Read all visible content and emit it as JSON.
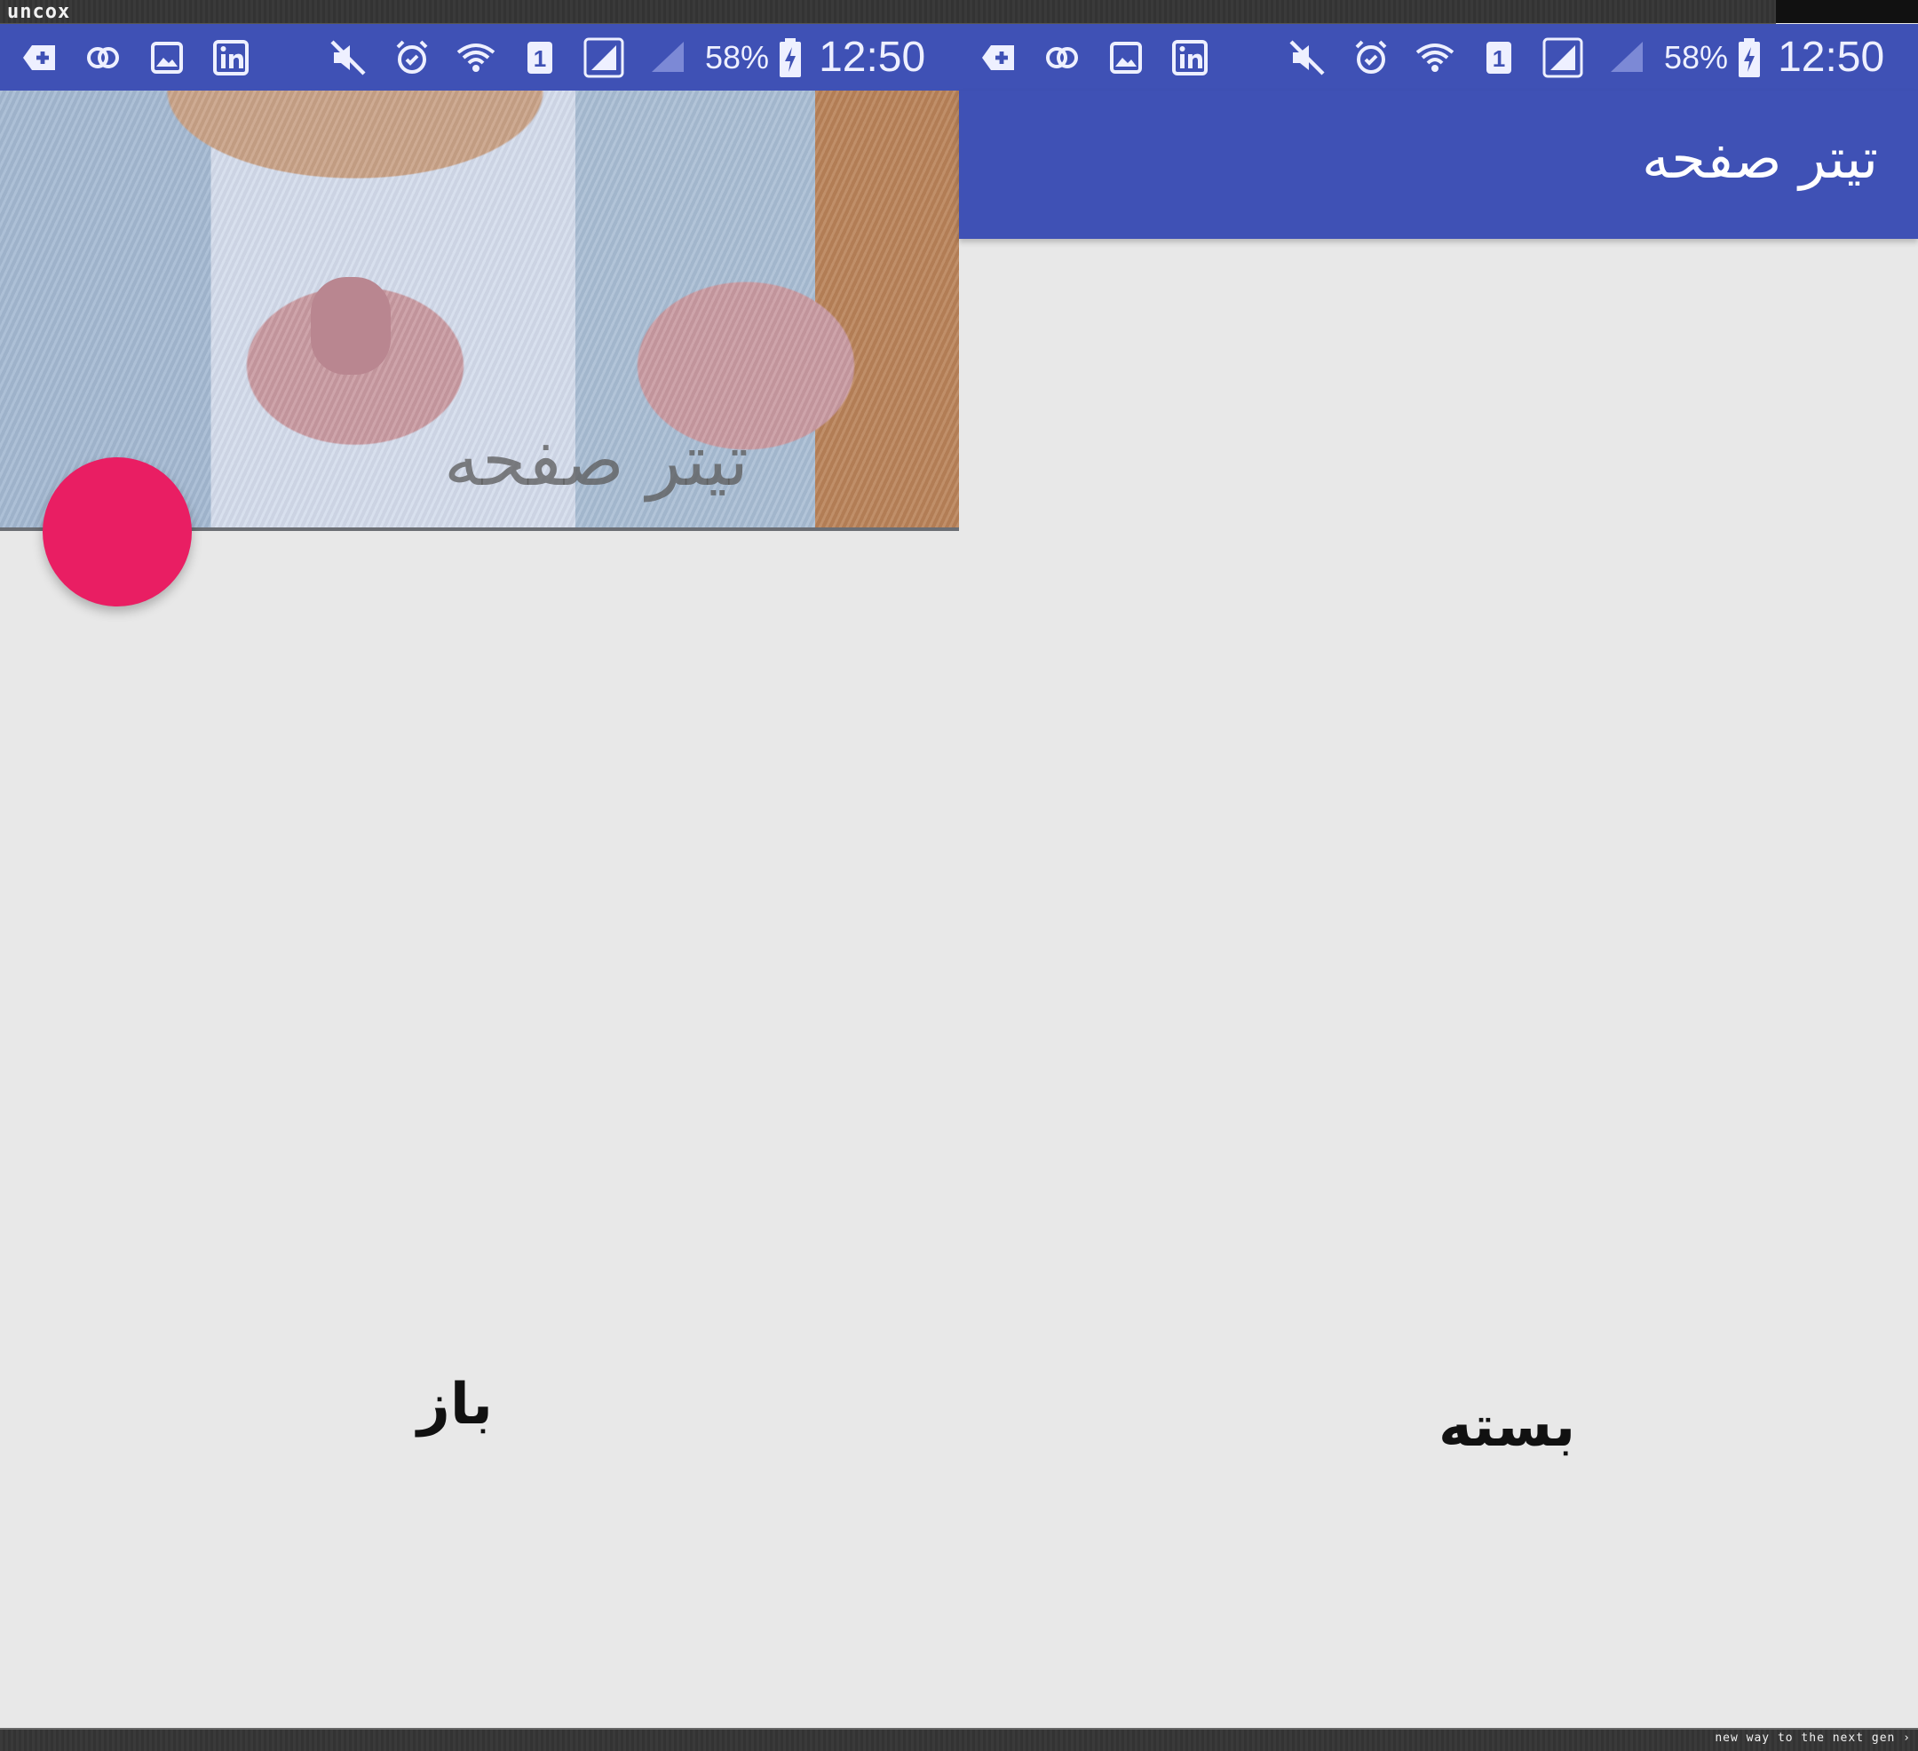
{
  "watermark": {
    "brand": "uncox",
    "tagline": "new way to the next gen ›"
  },
  "status_bar": {
    "battery": "58%",
    "time": "12:50",
    "sim_number": "1",
    "icons": [
      "add-box-icon",
      "link-icon",
      "gallery-icon",
      "linkedin-icon",
      "mute-icon",
      "alarm-icon",
      "wifi-icon",
      "sim-icon",
      "signal-icon",
      "signal-weak-icon",
      "battery-charging-icon"
    ]
  },
  "expanded_panel": {
    "title": "تیتر صفحه",
    "caption": "باز"
  },
  "collapsed_panel": {
    "title": "تیتر صفحه",
    "caption": "بسته"
  },
  "colors": {
    "primary": "#3f51b5",
    "accent": "#e91e63",
    "background": "#e8e8e8"
  }
}
